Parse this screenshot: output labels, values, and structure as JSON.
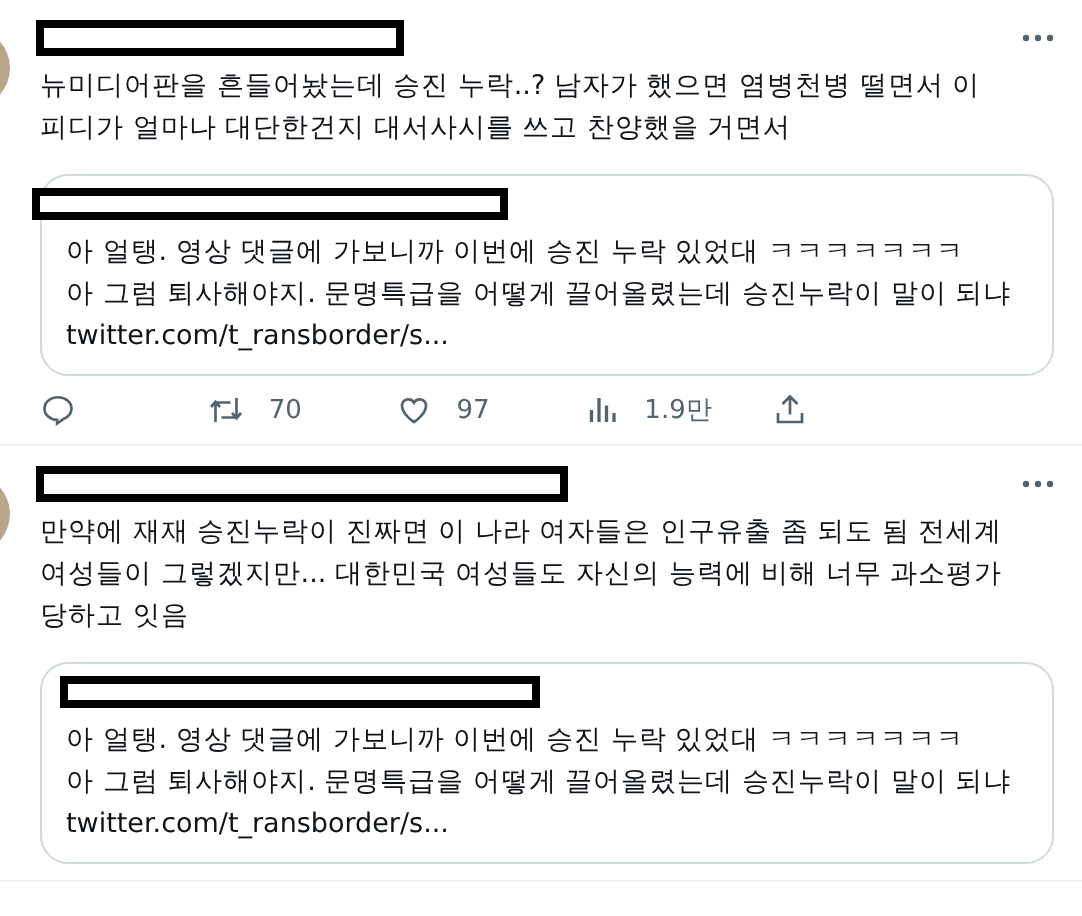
{
  "tweets": [
    {
      "text": "뉴미디어판을 흔들어놨는데 승진 누락..? 남자가 했으면 염병천병 떨면서 이 피디가 얼마나 대단한건지 대서사시를 쓰고 찬양했을 거면서",
      "quote": {
        "text": "아 얼탱. 영상 댓글에 가보니까 이번에 승진 누락 있었대 ㅋㅋㅋㅋㅋㅋㅋ\n아 그럼 퇴사해야지. 문명특급을 어떻게 끌어올렸는데 승진누락이 말이 되냐 twitter.com/t_ransborder/s..."
      },
      "actions": [
        {
          "kind": "reply"
        },
        {
          "kind": "retweet",
          "count": "70"
        },
        {
          "kind": "like",
          "count": "97"
        },
        {
          "kind": "views",
          "count": "1.9만"
        },
        {
          "kind": "share"
        }
      ]
    },
    {
      "text": "만약에 재재 승진누락이 진짜면 이 나라 여자들은 인구유출 좀 되도 됨 전세계 여성들이 그렇겠지만... 대한민국 여성들도 자신의 능력에 비해 너무 과소평가 당하고 잇음",
      "quote": {
        "text": "아 얼탱. 영상 댓글에 가보니까 이번에 승진 누락 있었대 ㅋㅋㅋㅋㅋㅋㅋ\n아 그럼 퇴사해야지. 문명특급을 어떻게 끌어올렸는데 승진누락이 말이 되냐 twitter.com/t_ransborder/s..."
      }
    }
  ]
}
